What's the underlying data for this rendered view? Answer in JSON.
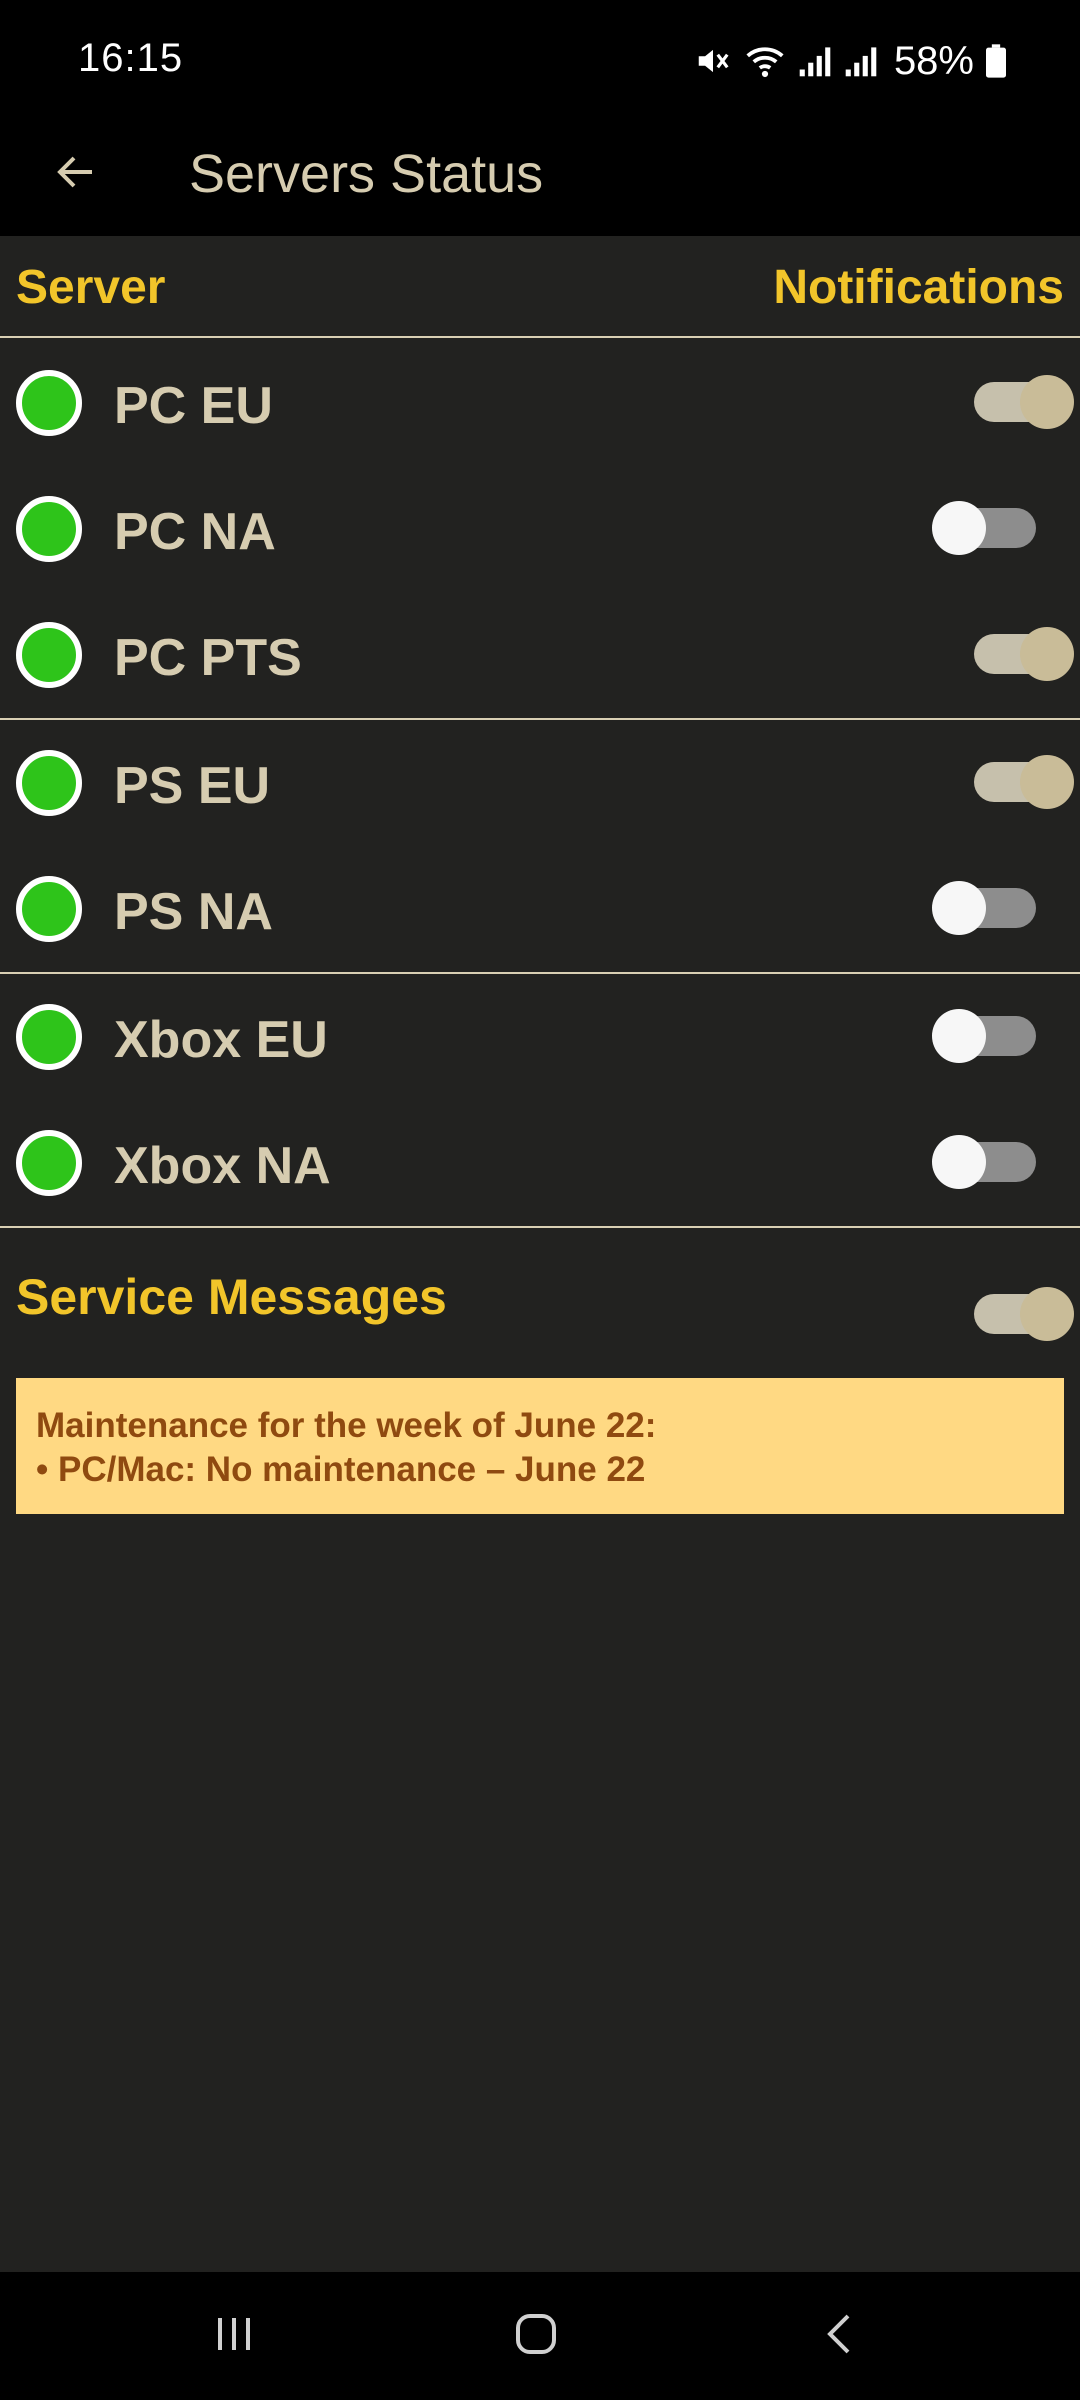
{
  "status_bar": {
    "time": "16:15",
    "battery": "58%",
    "icons": [
      "mute-icon",
      "wifi-icon",
      "signal-icon",
      "signal-icon",
      "battery-icon"
    ]
  },
  "app_bar": {
    "title": "Servers Status",
    "back_icon": "arrow-back-icon"
  },
  "table_header": {
    "server": "Server",
    "notifications": "Notifications"
  },
  "servers": [
    {
      "name": "PC EU",
      "online": true,
      "notifications": true
    },
    {
      "name": "PC NA",
      "online": true,
      "notifications": false
    },
    {
      "name": "PC PTS",
      "online": true,
      "notifications": true
    },
    {
      "name": "PS EU",
      "online": true,
      "notifications": true
    },
    {
      "name": "PS NA",
      "online": true,
      "notifications": false
    },
    {
      "name": "Xbox EU",
      "online": true,
      "notifications": false
    },
    {
      "name": "Xbox NA",
      "online": true,
      "notifications": false
    }
  ],
  "service_messages": {
    "label": "Service Messages",
    "enabled": true,
    "message_line1": "Maintenance for the week of June 22:",
    "message_line2": "• PC/Mac: No maintenance – June 22"
  },
  "nav_bar": {
    "icons": [
      "recent-apps-icon",
      "home-icon",
      "back-icon"
    ]
  },
  "colors": {
    "accent": "#f2c52a",
    "online": "#2ec41a",
    "label": "#d6ccb0",
    "background": "#222220",
    "message_bg": "#ffd983",
    "message_text": "#8f4a10"
  }
}
